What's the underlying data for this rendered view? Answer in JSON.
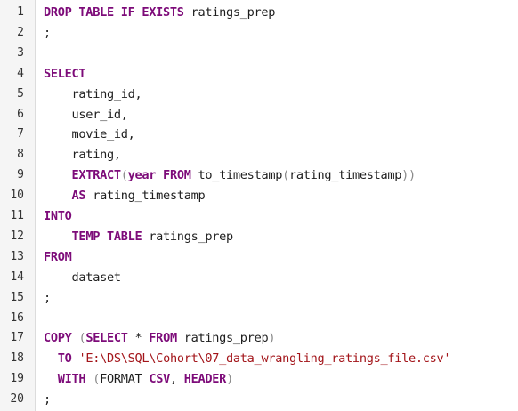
{
  "editor": {
    "lines": [
      {
        "num": "1",
        "tokens": [
          {
            "t": "kw",
            "v": "DROP TABLE IF EXISTS"
          },
          {
            "t": "id",
            "v": " ratings_prep"
          }
        ]
      },
      {
        "num": "2",
        "tokens": [
          {
            "t": "punct",
            "v": ";"
          }
        ]
      },
      {
        "num": "3",
        "tokens": []
      },
      {
        "num": "4",
        "tokens": [
          {
            "t": "kw",
            "v": "SELECT"
          }
        ]
      },
      {
        "num": "5",
        "tokens": [
          {
            "t": "id",
            "v": "    rating_id,"
          }
        ]
      },
      {
        "num": "6",
        "tokens": [
          {
            "t": "id",
            "v": "    user_id,"
          }
        ]
      },
      {
        "num": "7",
        "tokens": [
          {
            "t": "id",
            "v": "    movie_id,"
          }
        ]
      },
      {
        "num": "8",
        "tokens": [
          {
            "t": "id",
            "v": "    rating,"
          }
        ]
      },
      {
        "num": "9",
        "tokens": [
          {
            "t": "id",
            "v": "    "
          },
          {
            "t": "kw",
            "v": "EXTRACT"
          },
          {
            "t": "paren",
            "v": "("
          },
          {
            "t": "kw",
            "v": "year FROM"
          },
          {
            "t": "id",
            "v": " to_timestamp"
          },
          {
            "t": "paren",
            "v": "("
          },
          {
            "t": "id",
            "v": "rating_timestamp"
          },
          {
            "t": "paren",
            "v": "))"
          }
        ]
      },
      {
        "num": "10",
        "tokens": [
          {
            "t": "id",
            "v": "    "
          },
          {
            "t": "kw",
            "v": "AS"
          },
          {
            "t": "id",
            "v": " rating_timestamp"
          }
        ]
      },
      {
        "num": "11",
        "tokens": [
          {
            "t": "kw",
            "v": "INTO"
          }
        ]
      },
      {
        "num": "12",
        "tokens": [
          {
            "t": "id",
            "v": "    "
          },
          {
            "t": "kw",
            "v": "TEMP TABLE"
          },
          {
            "t": "id",
            "v": " ratings_prep"
          }
        ]
      },
      {
        "num": "13",
        "tokens": [
          {
            "t": "kw",
            "v": "FROM"
          }
        ]
      },
      {
        "num": "14",
        "tokens": [
          {
            "t": "id",
            "v": "    dataset"
          }
        ]
      },
      {
        "num": "15",
        "tokens": [
          {
            "t": "punct",
            "v": ";"
          }
        ]
      },
      {
        "num": "16",
        "tokens": []
      },
      {
        "num": "17",
        "tokens": [
          {
            "t": "kw",
            "v": "COPY"
          },
          {
            "t": "id",
            "v": " "
          },
          {
            "t": "paren",
            "v": "("
          },
          {
            "t": "kw",
            "v": "SELECT"
          },
          {
            "t": "id",
            "v": " * "
          },
          {
            "t": "kw",
            "v": "FROM"
          },
          {
            "t": "id",
            "v": " ratings_prep"
          },
          {
            "t": "paren",
            "v": ")"
          }
        ]
      },
      {
        "num": "18",
        "tokens": [
          {
            "t": "id",
            "v": "  "
          },
          {
            "t": "kw",
            "v": "TO"
          },
          {
            "t": "id",
            "v": " "
          },
          {
            "t": "str",
            "v": "'E:\\DS\\SQL\\Cohort\\07_data_wrangling_ratings_file.csv'"
          }
        ]
      },
      {
        "num": "19",
        "tokens": [
          {
            "t": "id",
            "v": "  "
          },
          {
            "t": "kw",
            "v": "WITH"
          },
          {
            "t": "id",
            "v": " "
          },
          {
            "t": "paren",
            "v": "("
          },
          {
            "t": "id",
            "v": "FORMAT "
          },
          {
            "t": "kw",
            "v": "CSV"
          },
          {
            "t": "id",
            "v": ", "
          },
          {
            "t": "kw",
            "v": "HEADER"
          },
          {
            "t": "paren",
            "v": ")"
          }
        ]
      },
      {
        "num": "20",
        "tokens": [
          {
            "t": "punct",
            "v": ";"
          }
        ]
      }
    ]
  },
  "colors": {
    "keyword": "#7d0b79",
    "identifier": "#1e1e1e",
    "string": "#a3151a",
    "paren": "#8a8a8a",
    "gutter_bg": "#f5f5f5",
    "background": "#ffffff"
  }
}
